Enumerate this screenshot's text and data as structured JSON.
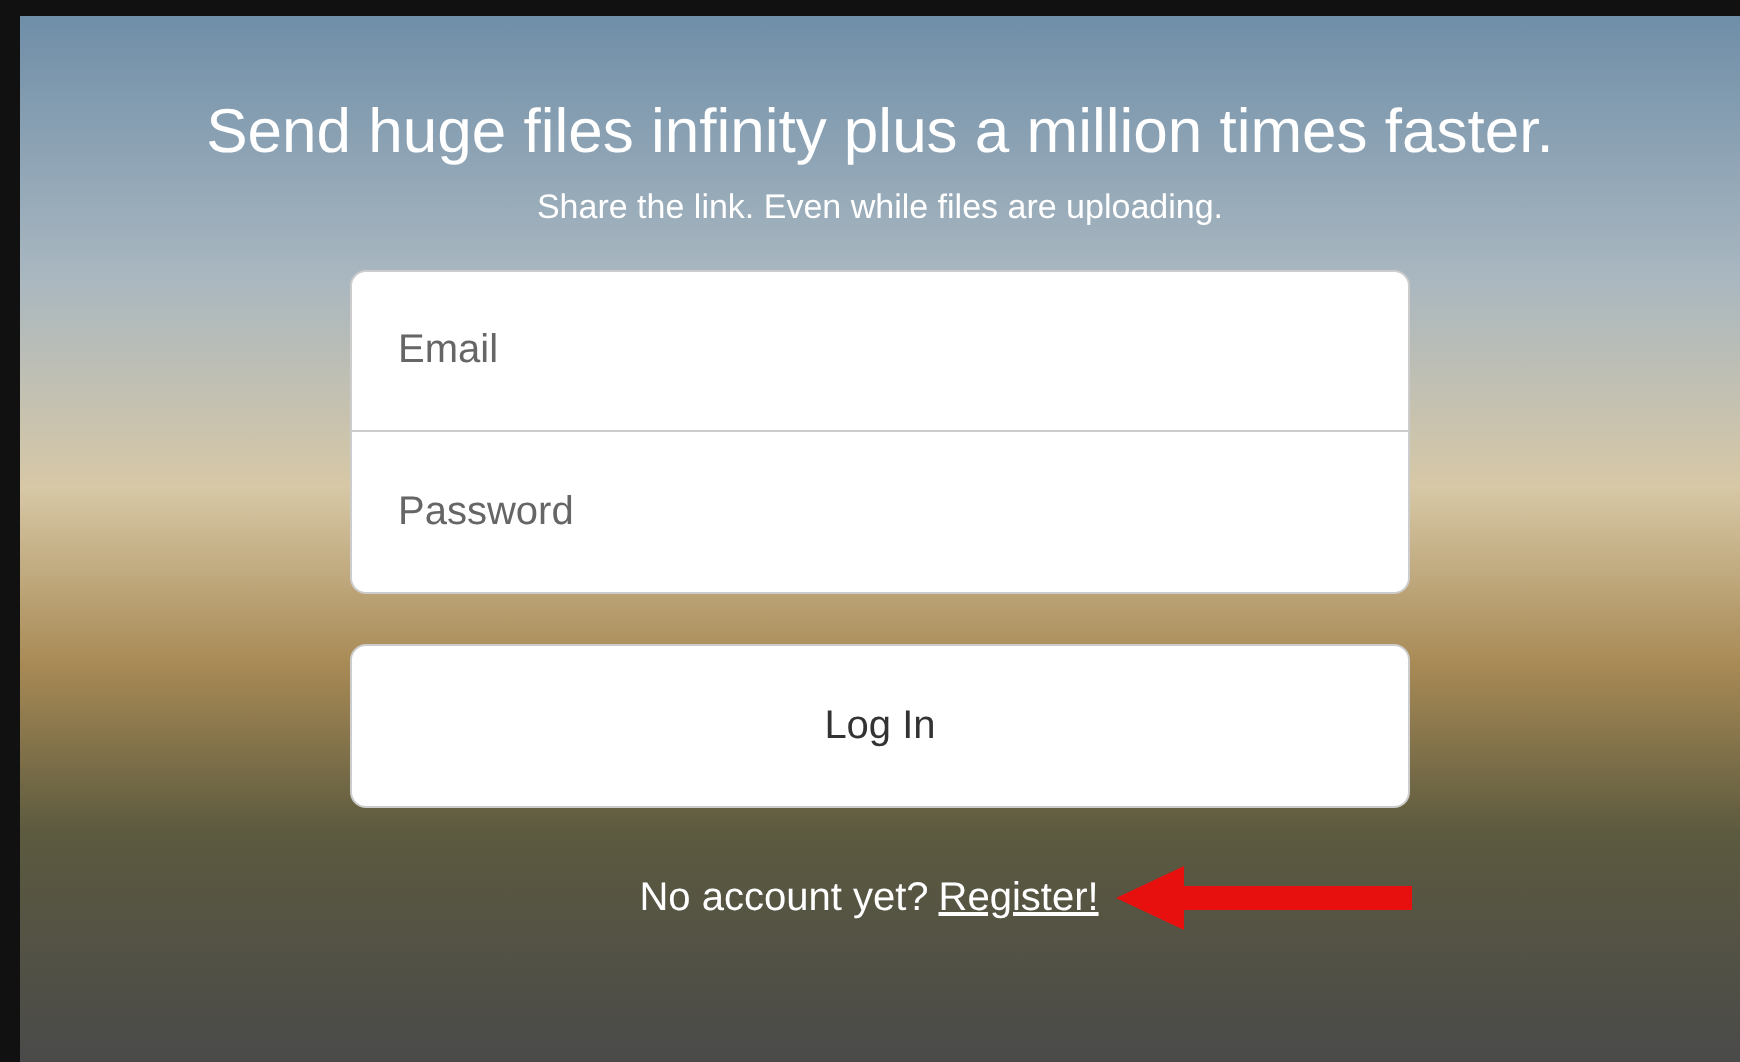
{
  "headline": "Send huge files infinity plus a million times faster.",
  "subheadline": "Share the link. Even while files are uploading.",
  "fields": [
    {
      "placeholder": "Email"
    },
    {
      "placeholder": "Password"
    }
  ],
  "login_button": "Log In",
  "register_prompt": {
    "text": "No account yet?",
    "link": "Register!"
  }
}
